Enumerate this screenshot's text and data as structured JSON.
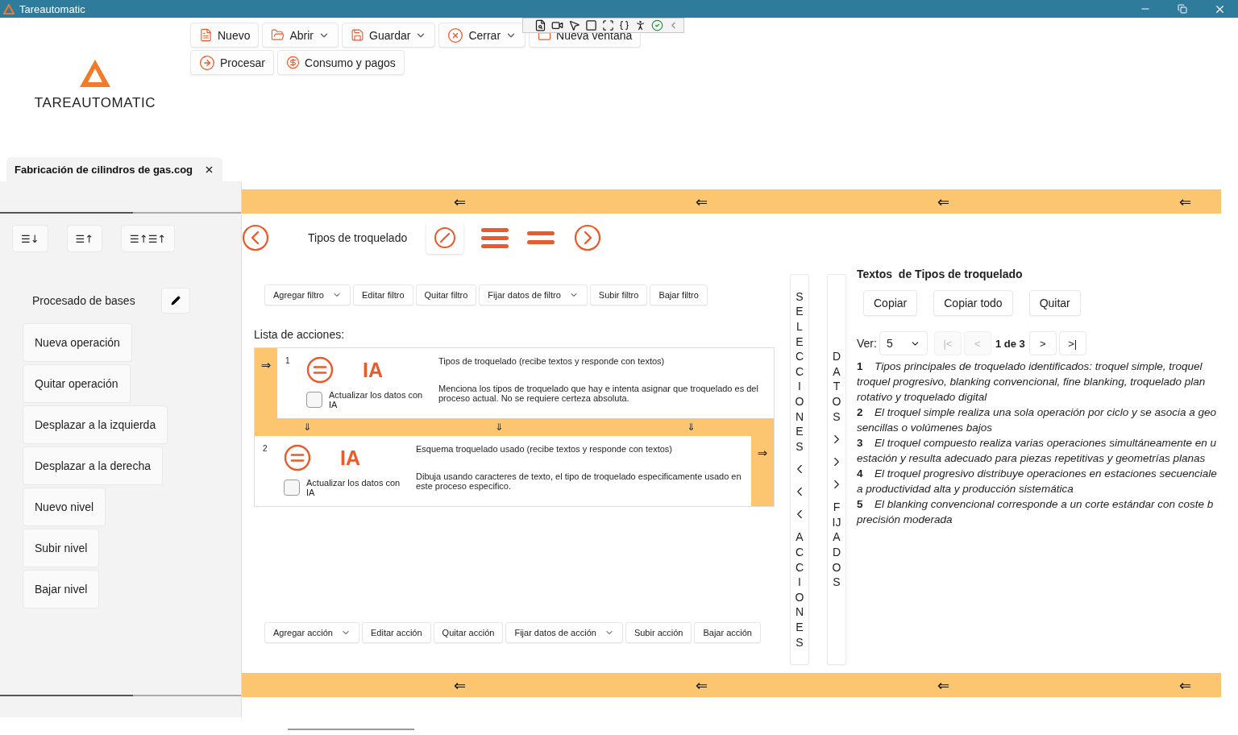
{
  "window": {
    "title": "Tareautomatic"
  },
  "logo": {
    "text": "TAREAUTOMATIC"
  },
  "ribbon": [
    [
      {
        "label": "Nuevo",
        "dropdown": false
      },
      {
        "label": "Abrir",
        "dropdown": true
      },
      {
        "label": "Guardar",
        "dropdown": true
      },
      {
        "label": "Cerrar",
        "dropdown": true
      },
      {
        "label": "Nueva ventana",
        "dropdown": false
      }
    ],
    [
      {
        "label": "Procesar",
        "dropdown": false
      },
      {
        "label": "Consumo y pagos",
        "dropdown": false
      }
    ]
  ],
  "document_tab": {
    "label": "Fabricación de cilindros de gas.cog",
    "selected": true
  },
  "sidebar": {
    "sort_buttons": [
      "☰↓",
      "☰↑",
      "☰↑☰↑"
    ],
    "group_title": "Procesado de bases",
    "items": [
      "Nueva operación",
      "Quitar operación",
      "Desplazar a la izquierda",
      "Desplazar a la derecha",
      "Nuevo nivel",
      "Subir nivel",
      "Bajar nivel"
    ]
  },
  "top_band": {
    "arrows": [
      "⇐",
      "⇐",
      "⇐",
      "⇐"
    ]
  },
  "operation": {
    "title": "Tipos de troquelado"
  },
  "filter_toolbar": [
    {
      "label": "Agregar filtro",
      "dropdown": true
    },
    {
      "label": "Editar filtro",
      "dropdown": false
    },
    {
      "label": "Quitar filtro",
      "dropdown": false
    },
    {
      "label": "Fijar datos de filtro",
      "dropdown": true
    },
    {
      "label": "Subir filtro",
      "dropdown": false
    },
    {
      "label": "Bajar filtro",
      "dropdown": false
    }
  ],
  "actions_heading": "Lista de acciones:",
  "actions": [
    {
      "number": "1",
      "badge": "IA",
      "title": "Tipos de troquelado (recibe textos y responde con textos)",
      "description": "Menciona los tipos de troquelado que hay e intenta asignar que troquelado es del proceso actual. No se requiere certeza absoluta.",
      "checkbox_label": "Actualizar los datos con IA",
      "checked": false,
      "arrow": "⇒",
      "kind": "leading"
    },
    {
      "number": "2",
      "badge": "IA",
      "title": "Esquema troquelado usado (recibe textos y responde con textos)",
      "description": "Dibuja usando caracteres de texto, el tipo de troquelado especificamente usado en este proceso especifico.",
      "checkbox_label": "Actualizar los datos con IA",
      "checked": false,
      "arrow": "⇒",
      "kind": "trailing"
    }
  ],
  "action_connector": [
    "⇓",
    "⇓",
    "⇓"
  ],
  "action_toolbar": [
    {
      "label": "Agregar acción",
      "dropdown": true
    },
    {
      "label": "Editar acción",
      "dropdown": false
    },
    {
      "label": "Quitar acción",
      "dropdown": false
    },
    {
      "label": "Fijar datos de acción",
      "dropdown": true
    },
    {
      "label": "Subir acción",
      "dropdown": false
    },
    {
      "label": "Bajar acción",
      "dropdown": false
    }
  ],
  "side_strips": [
    {
      "top": "SELECCIONES",
      "bottom": "ACCIONES",
      "kind": "back"
    },
    {
      "top": "DATOS",
      "bottom": "FIJADOS",
      "kind": "forward"
    }
  ],
  "texts_panel": {
    "title": "Textos  de Tipos de troquelado",
    "buttons": [
      "Copiar",
      "Copiar todo",
      "Quitar"
    ],
    "view_label": "Ver:",
    "view_value": "5",
    "pager": [
      {
        "label": "|<",
        "disabled": true
      },
      {
        "label": "<",
        "disabled": true
      },
      {
        "label": "1 de 3",
        "kind": "status"
      },
      {
        "label": ">",
        "disabled": false
      },
      {
        "label": ">|",
        "disabled": false
      }
    ],
    "items": [
      {
        "number": "1",
        "lines": [
          "Tipos principales de troquelado identificados: troquel simple, troquel",
          "troquel progresivo, blanking convencional, fine blanking, troquelado plan",
          "rotativo y troquelado digital"
        ]
      },
      {
        "number": "2",
        "lines": [
          "El troquel simple realiza una sola operación por ciclo y se asocia a geo",
          "sencillas o volúmenes bajos"
        ]
      },
      {
        "number": "3",
        "lines": [
          "El troquel compuesto realiza varias operaciones simultáneamente en u",
          "estación y resulta adecuado para piezas repetitivas y geometrías planas"
        ]
      },
      {
        "number": "4",
        "lines": [
          "El troquel progresivo distribuye operaciones en estaciones secuenciale",
          "a productividad alta y producción sistemática"
        ]
      },
      {
        "number": "5",
        "lines": [
          "El blanking convencional corresponde a un corte estándar con coste b",
          "precisión moderada"
        ]
      }
    ]
  },
  "bottom_band": {
    "arrows": [
      "⇐",
      "⇐",
      "⇐",
      "⇐"
    ]
  }
}
